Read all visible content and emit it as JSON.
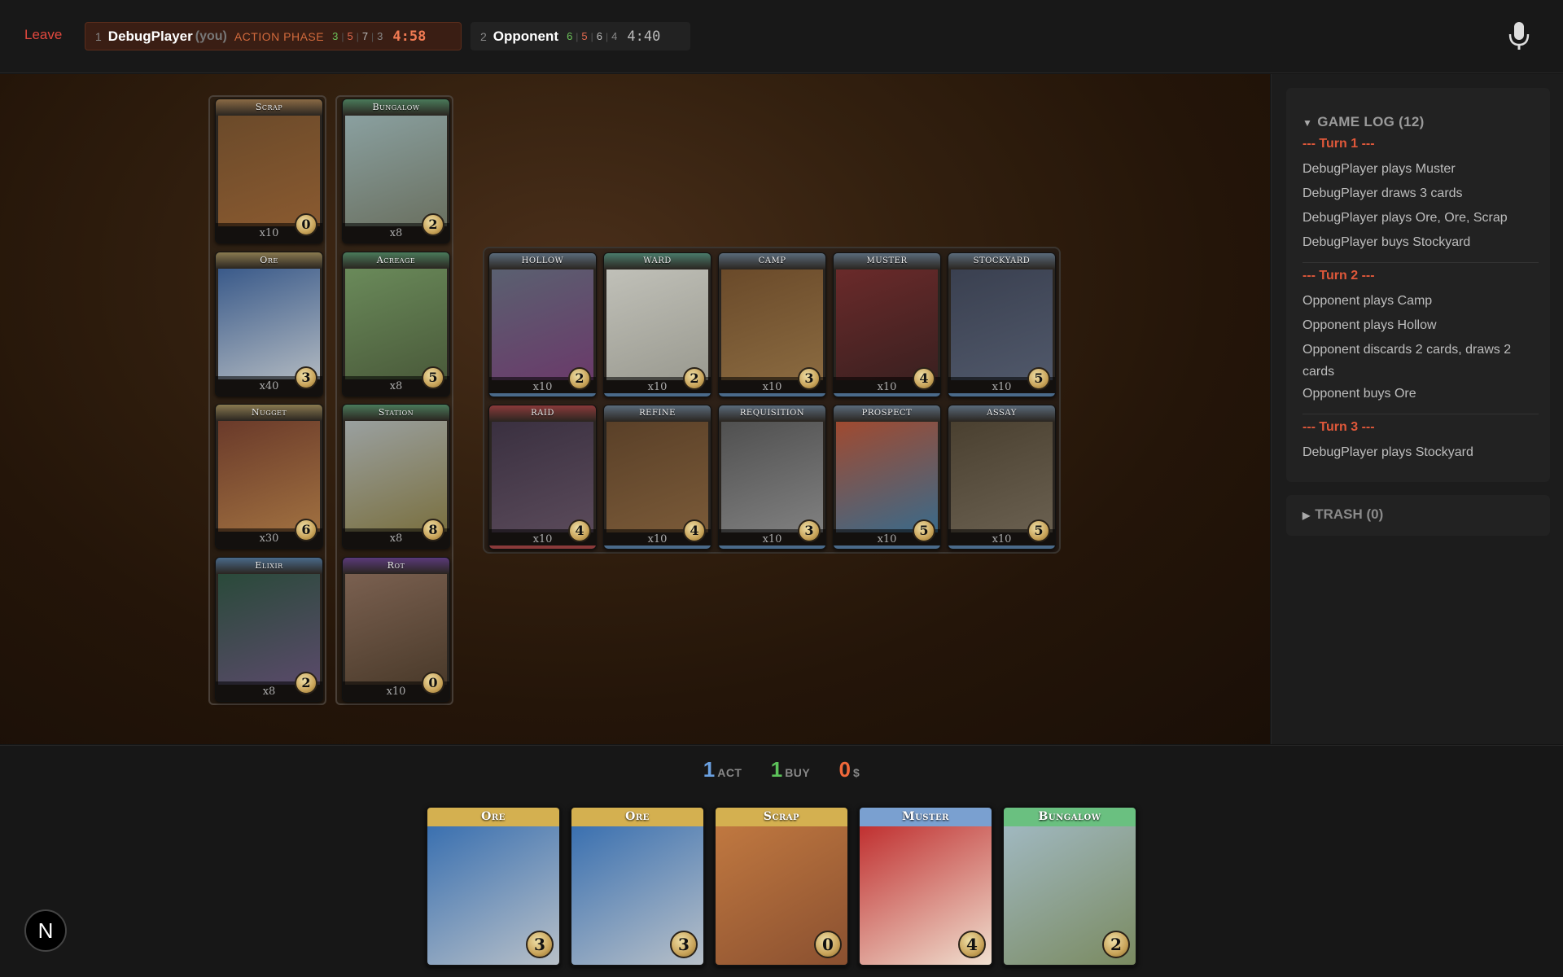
{
  "topbar": {
    "leave_label": "Leave",
    "player1": {
      "index": "1",
      "name": "DebugPlayer",
      "you": "(you)",
      "phase": "ACTION PHASE",
      "stats": [
        "3",
        "5",
        "7",
        "3"
      ],
      "timer": "4:58"
    },
    "player2": {
      "index": "2",
      "name": "Opponent",
      "stats": [
        "6",
        "5",
        "6",
        "4"
      ],
      "timer": "4:40"
    },
    "mic_icon": "microphone-icon"
  },
  "base_supply": [
    {
      "name": "Scrap",
      "count": "x10",
      "cost": "0",
      "color": "#8a6a45",
      "art": [
        "#6b4a2a",
        "#8a5a30"
      ]
    },
    {
      "name": "Bungalow",
      "count": "x8",
      "cost": "2",
      "color": "#4a7a5a",
      "art": [
        "#8aa0a0",
        "#6a7060"
      ]
    },
    {
      "name": "Ore",
      "count": "x40",
      "cost": "3",
      "color": "#8a7a50",
      "art": [
        "#3a5a8a",
        "#b0b8c0"
      ]
    },
    {
      "name": "Acreage",
      "count": "x8",
      "cost": "5",
      "color": "#4a7a5a",
      "art": [
        "#6a8a5a",
        "#4a5a3a"
      ]
    },
    {
      "name": "Nugget",
      "count": "x30",
      "cost": "6",
      "color": "#8a7a50",
      "art": [
        "#6a3a2a",
        "#a07040"
      ]
    },
    {
      "name": "Station",
      "count": "x8",
      "cost": "8",
      "color": "#4a7a5a",
      "art": [
        "#9aa0a0",
        "#7a7040"
      ]
    },
    {
      "name": "Elixir",
      "count": "x8",
      "cost": "2",
      "color": "#4a6a8a",
      "art": [
        "#2a4a3a",
        "#5a4a6a"
      ]
    },
    {
      "name": "Rot",
      "count": "x10",
      "cost": "0",
      "color": "#5a3a7a",
      "art": [
        "#7a6050",
        "#4a3a2a"
      ]
    }
  ],
  "kingdom": [
    {
      "name": "Hollow",
      "count": "x10",
      "cost": "2",
      "color": "#5a6a7a",
      "edge": "#4a6a8a",
      "art": [
        "#5a6070",
        "#6a3a6a"
      ]
    },
    {
      "name": "Ward",
      "count": "x10",
      "cost": "2",
      "color": "#4a7a6a",
      "edge": "#4a6a8a",
      "art": [
        "#c0c0b8",
        "#9a9a90"
      ]
    },
    {
      "name": "Camp",
      "count": "x10",
      "cost": "3",
      "color": "#5a6a7a",
      "edge": "#4a6a8a",
      "art": [
        "#6a4a2a",
        "#8a6a40"
      ]
    },
    {
      "name": "Muster",
      "count": "x10",
      "cost": "4",
      "color": "#5a6a7a",
      "edge": "#4a6a8a",
      "art": [
        "#6a2a2a",
        "#3a2020"
      ]
    },
    {
      "name": "Stockyard",
      "count": "x10",
      "cost": "5",
      "color": "#5a6a7a",
      "edge": "#4a6a8a",
      "art": [
        "#3a4050",
        "#50586a"
      ]
    },
    {
      "name": "Raid",
      "count": "x10",
      "cost": "4",
      "color": "#8a3a3a",
      "edge": "#8a3a3a",
      "art": [
        "#3a3040",
        "#5a4a5a"
      ]
    },
    {
      "name": "Refine",
      "count": "x10",
      "cost": "4",
      "color": "#5a6a7a",
      "edge": "#4a6a8a",
      "art": [
        "#5a4028",
        "#7a5a38"
      ]
    },
    {
      "name": "Requisition",
      "count": "x10",
      "cost": "3",
      "color": "#5a6a7a",
      "edge": "#4a6a8a",
      "art": [
        "#505050",
        "#808080"
      ]
    },
    {
      "name": "Prospect",
      "count": "x10",
      "cost": "5",
      "color": "#5a6a7a",
      "edge": "#4a6a8a",
      "art": [
        "#a04a30",
        "#3a6a8a"
      ]
    },
    {
      "name": "Assay",
      "count": "x10",
      "cost": "5",
      "color": "#5a6a7a",
      "edge": "#4a6a8a",
      "art": [
        "#4a4030",
        "#6a6050"
      ]
    }
  ],
  "sidebar": {
    "log_title": "GAME LOG (12)",
    "turns": [
      {
        "header": "--- Turn 1 ---",
        "lines": [
          "DebugPlayer plays Muster",
          "DebugPlayer draws 3 cards",
          "DebugPlayer plays Ore, Ore, Scrap",
          "DebugPlayer buys Stockyard"
        ]
      },
      {
        "header": "--- Turn 2 ---",
        "lines": [
          "Opponent plays Camp",
          "Opponent plays Hollow",
          "Opponent discards 2 cards, draws 2 cards",
          "Opponent buys Ore"
        ]
      },
      {
        "header": "--- Turn 3 ---",
        "lines": [
          "DebugPlayer plays Stockyard"
        ]
      }
    ],
    "trash_title": "TRASH (0)"
  },
  "resources": {
    "act_value": "1",
    "act_label": "ACT",
    "act_color": "#6aa0e0",
    "buy_value": "1",
    "buy_label": "BUY",
    "buy_color": "#5cc25a",
    "money_value": "0",
    "money_label": "$",
    "money_color": "#f0683a"
  },
  "hand": [
    {
      "name": "Ore",
      "cost": "3",
      "bar": "#d4b050",
      "art": [
        "#3a70b0",
        "#b8c0c8"
      ]
    },
    {
      "name": "Ore",
      "cost": "3",
      "bar": "#d4b050",
      "art": [
        "#3a70b0",
        "#b8c0c8"
      ]
    },
    {
      "name": "Scrap",
      "cost": "0",
      "bar": "#d4b050",
      "art": [
        "#c07840",
        "#8a5030"
      ]
    },
    {
      "name": "Muster",
      "cost": "4",
      "bar": "#7aa0d0",
      "art": [
        "#c03030",
        "#f0e0d0"
      ]
    },
    {
      "name": "Bungalow",
      "cost": "2",
      "bar": "#6ac080",
      "art": [
        "#a0b8c0",
        "#7a8a60"
      ]
    }
  ],
  "logo_text": "N"
}
